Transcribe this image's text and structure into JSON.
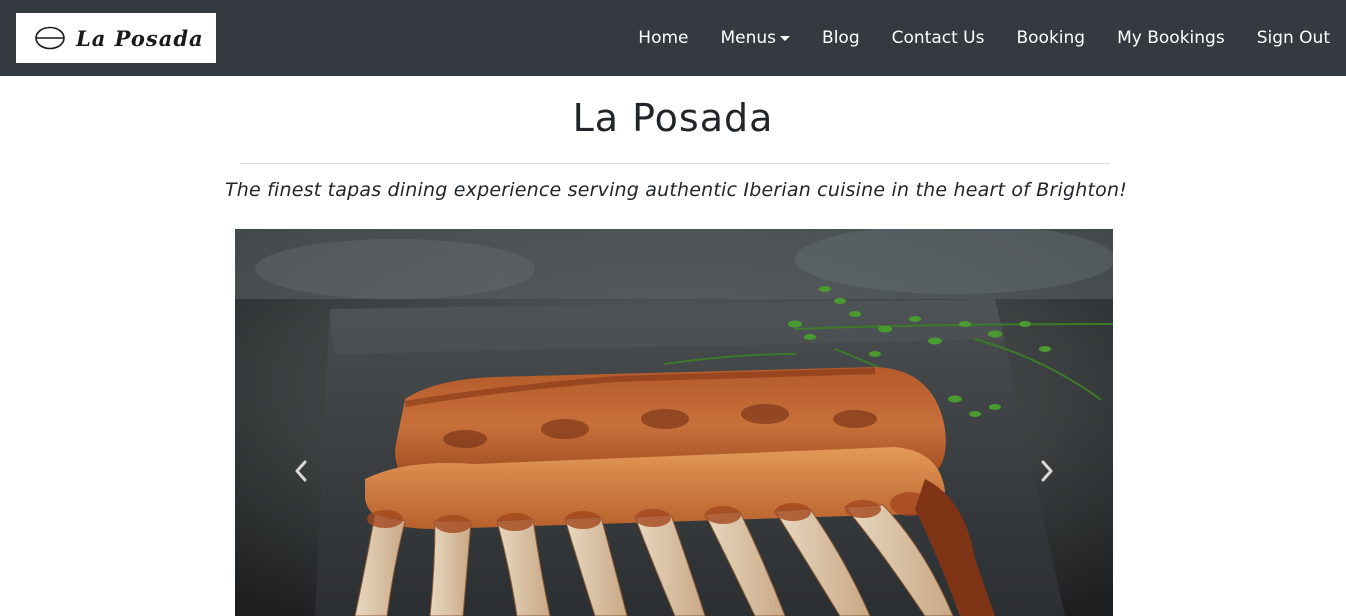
{
  "brand": {
    "name": "La Posada"
  },
  "nav": {
    "items": [
      {
        "label": "Home"
      },
      {
        "label": "Menus",
        "dropdown": true
      },
      {
        "label": "Blog"
      },
      {
        "label": "Contact Us"
      },
      {
        "label": "Booking"
      },
      {
        "label": "My Bookings"
      },
      {
        "label": "Sign Out"
      }
    ]
  },
  "hero": {
    "title": "La Posada",
    "tagline": "The finest tapas dining experience serving authentic Iberian cuisine in the heart of Brighton!"
  },
  "carousel": {
    "prev_icon": "chevron-left-icon",
    "next_icon": "chevron-right-icon"
  },
  "colors": {
    "navbar_bg": "#343a40",
    "nav_text": "#ffffff",
    "page_bg": "#ffffff",
    "text": "#212529"
  }
}
